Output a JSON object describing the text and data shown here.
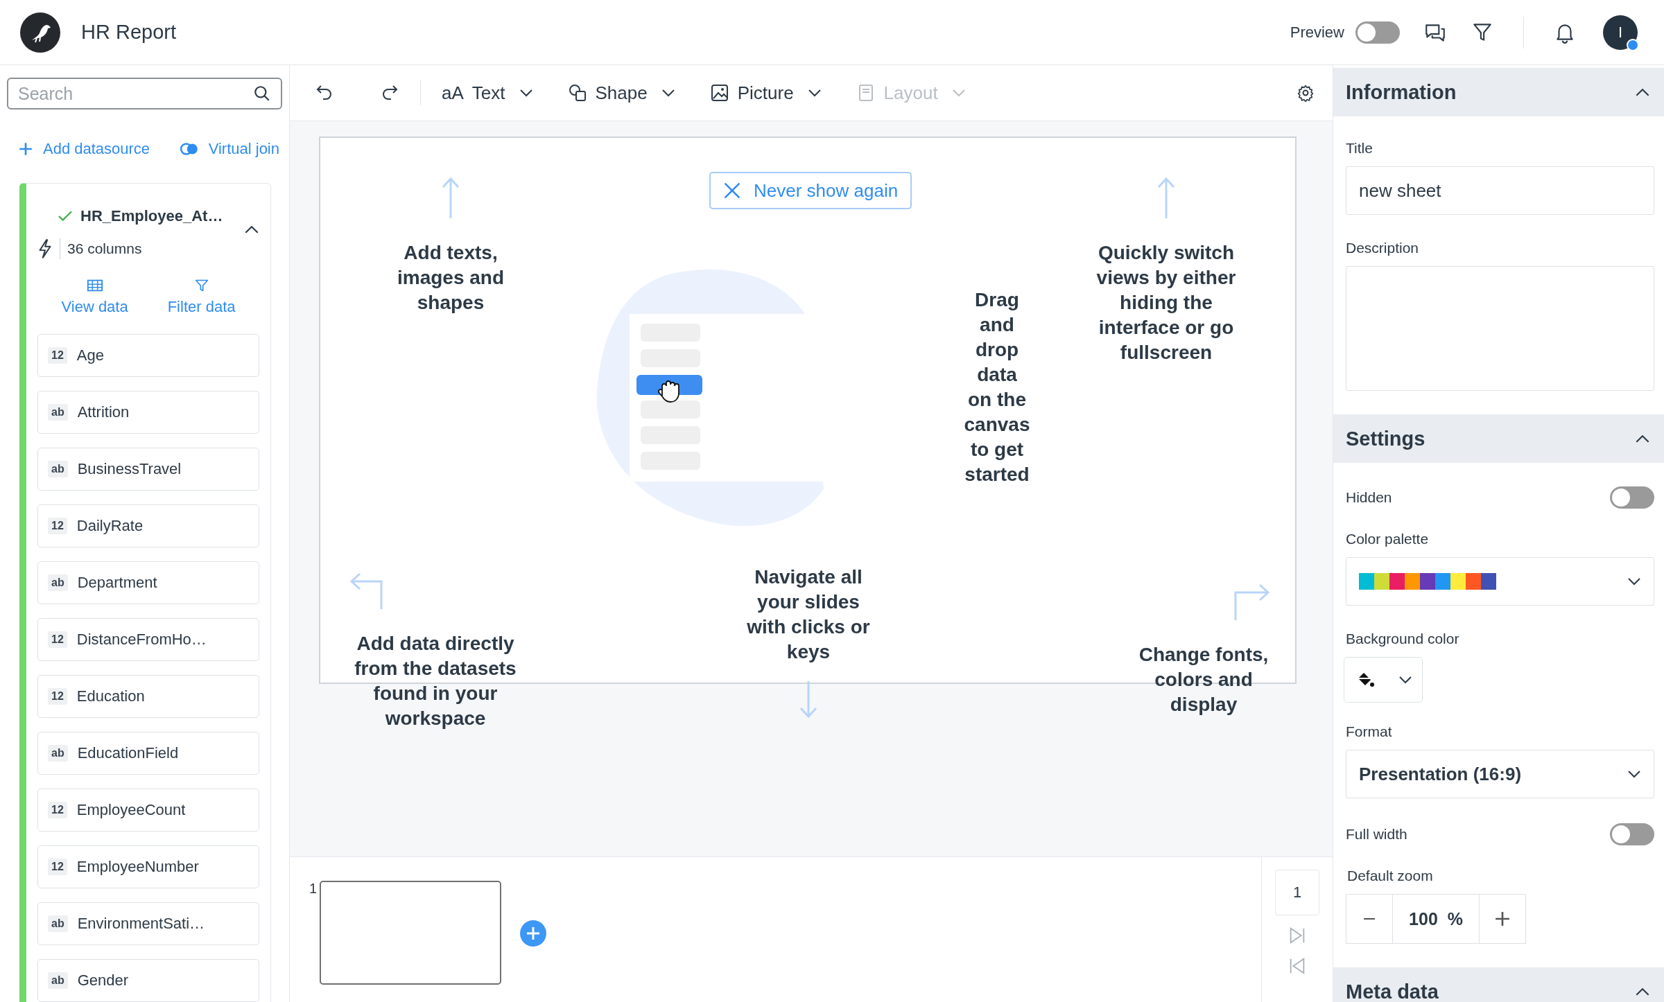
{
  "app": {
    "title": "HR Report"
  },
  "header": {
    "preview_label": "Preview",
    "preview_on": false,
    "avatar_initial": "I",
    "unread": true
  },
  "sidebar": {
    "search": {
      "placeholder": "Search"
    },
    "actions": [
      {
        "kind": "add",
        "label": "Add datasource"
      },
      {
        "kind": "join",
        "label": "Virtual join"
      }
    ],
    "datasource": {
      "name": "HR_Employee_At…",
      "columns": "36 columns",
      "connected": true,
      "expanded": true,
      "actions": [
        {
          "kind": "table",
          "label": "View data"
        },
        {
          "kind": "filter",
          "label": "Filter data"
        }
      ],
      "fields": [
        {
          "type": "12",
          "name": "Age"
        },
        {
          "type": "ab",
          "name": "Attrition"
        },
        {
          "type": "ab",
          "name": "BusinessTravel"
        },
        {
          "type": "12",
          "name": "DailyRate"
        },
        {
          "type": "ab",
          "name": "Department"
        },
        {
          "type": "12",
          "name": "DistanceFromHo…"
        },
        {
          "type": "12",
          "name": "Education"
        },
        {
          "type": "ab",
          "name": "EducationField"
        },
        {
          "type": "12",
          "name": "EmployeeCount"
        },
        {
          "type": "12",
          "name": "EmployeeNumber"
        },
        {
          "type": "ab",
          "name": "EnvironmentSati…"
        },
        {
          "type": "ab",
          "name": "Gender"
        }
      ]
    }
  },
  "toolbar": {
    "menus": [
      {
        "kind": "text",
        "label": "Text",
        "prefix": "aA",
        "disabled": false
      },
      {
        "kind": "shape",
        "label": "Shape",
        "disabled": false
      },
      {
        "kind": "picture",
        "label": "Picture",
        "disabled": false
      },
      {
        "kind": "layout",
        "label": "Layout",
        "disabled": true
      }
    ]
  },
  "canvas": {
    "dismiss_button": "Never show again",
    "tips": [
      {
        "kind": "toolbar",
        "text": "Add texts, images and shapes"
      },
      {
        "kind": "canvas",
        "text": "Drag and drop data on the canvas to get started"
      },
      {
        "kind": "fullscreen",
        "text": "Quickly switch views by either hiding the interface or go fullscreen"
      },
      {
        "kind": "datasets",
        "text": "Add data directly from the datasets found in your workspace"
      },
      {
        "kind": "navigation",
        "text": "Navigate all your slides with clicks or keys"
      },
      {
        "kind": "styling",
        "text": "Change fonts, colors and display"
      }
    ]
  },
  "slides": [
    {
      "number": "1"
    }
  ],
  "pager": {
    "current": "1"
  },
  "panel": {
    "sections": [
      {
        "kind": "information",
        "title": "Information",
        "expanded": true
      },
      {
        "kind": "settings",
        "title": "Settings",
        "expanded": true
      },
      {
        "kind": "meta",
        "title": "Meta data",
        "expanded": true
      }
    ],
    "information": {
      "title_label": "Title",
      "title_value": "new sheet",
      "description_label": "Description"
    },
    "settings": {
      "hidden_label": "Hidden",
      "hidden_on": false,
      "palette_label": "Color palette",
      "palette": [
        {
          "color": "#00bcd4"
        },
        {
          "color": "#cddc39"
        },
        {
          "color": "#e91e63"
        },
        {
          "color": "#ff9800"
        },
        {
          "color": "#673ab7"
        },
        {
          "color": "#2196f3"
        },
        {
          "color": "#ffeb3b"
        },
        {
          "color": "#ff5722"
        },
        {
          "color": "#3f51b5"
        }
      ],
      "background_label": "Background color",
      "format_label": "Format",
      "format_value": "Presentation (16:9)",
      "full_width_label": "Full width",
      "full_width_on": false,
      "zoom_label": "Default zoom",
      "zoom_value": "100",
      "zoom_unit": "%"
    }
  }
}
